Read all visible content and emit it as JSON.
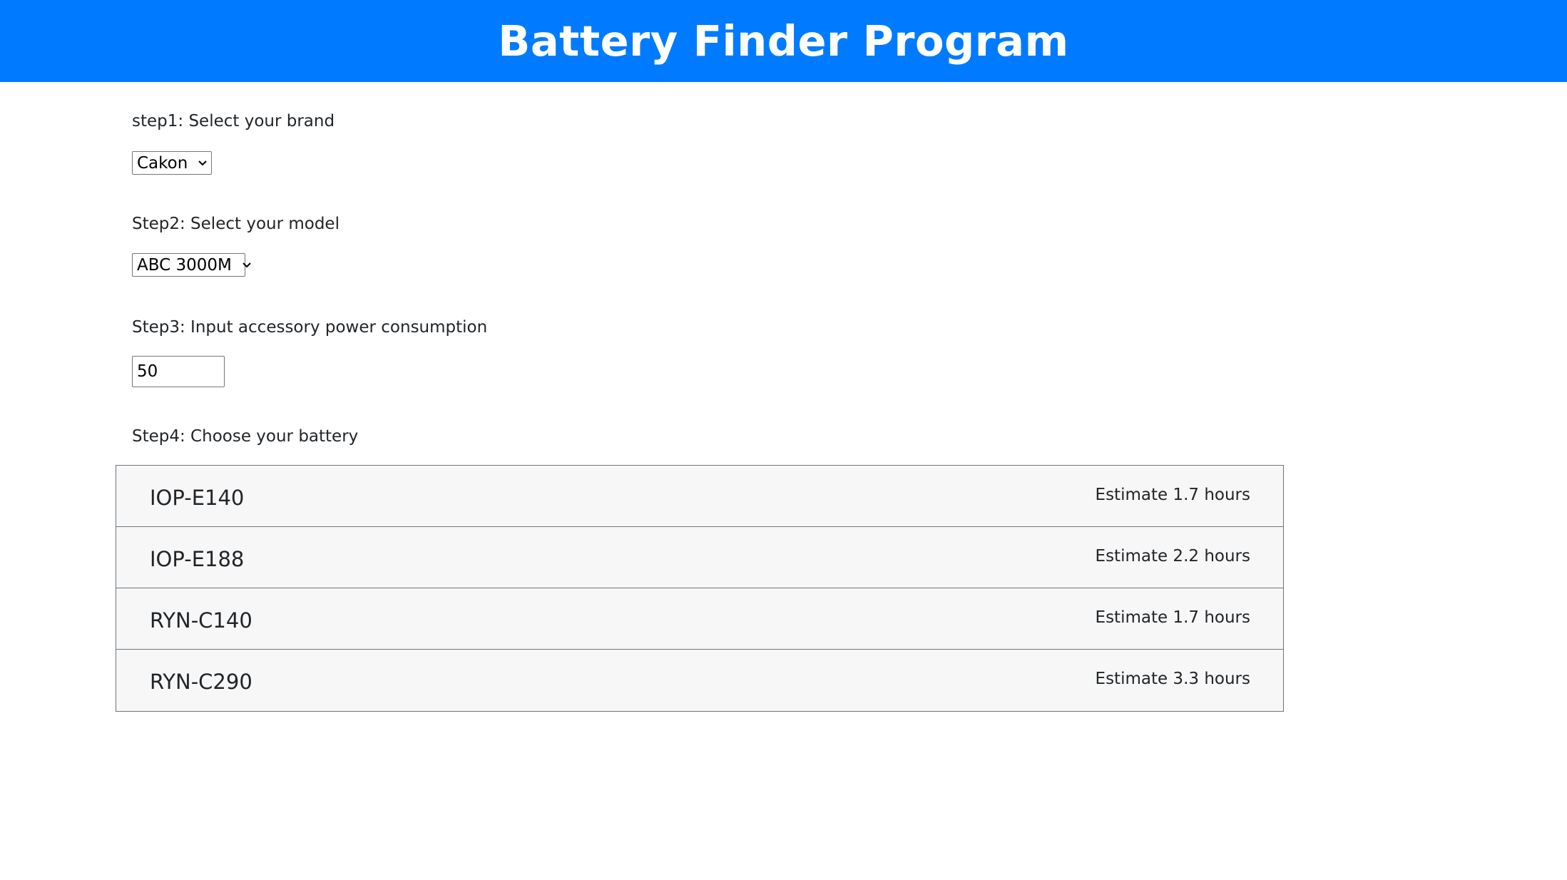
{
  "header": {
    "title": "Battery Finder Program"
  },
  "step1": {
    "label": "step1: Select your brand",
    "selected": "Cakon"
  },
  "step2": {
    "label": "Step2: Select your model",
    "selected": "ABC 3000M"
  },
  "step3": {
    "label": "Step3: Input accessory power consumption",
    "value": "50"
  },
  "step4": {
    "label": "Step4: Choose your battery",
    "batteries": [
      {
        "name": "IOP-E140",
        "estimate": "Estimate 1.7 hours"
      },
      {
        "name": "IOP-E188",
        "estimate": "Estimate 2.2 hours"
      },
      {
        "name": "RYN-C140",
        "estimate": "Estimate 1.7 hours"
      },
      {
        "name": "RYN-C290",
        "estimate": "Estimate 3.3 hours"
      }
    ]
  },
  "icons": {
    "dropdown": "chevron-down-icon"
  },
  "colors": {
    "header_bg": "#007bff",
    "header_text": "#ffffff",
    "list_bg": "#f7f7f7"
  }
}
